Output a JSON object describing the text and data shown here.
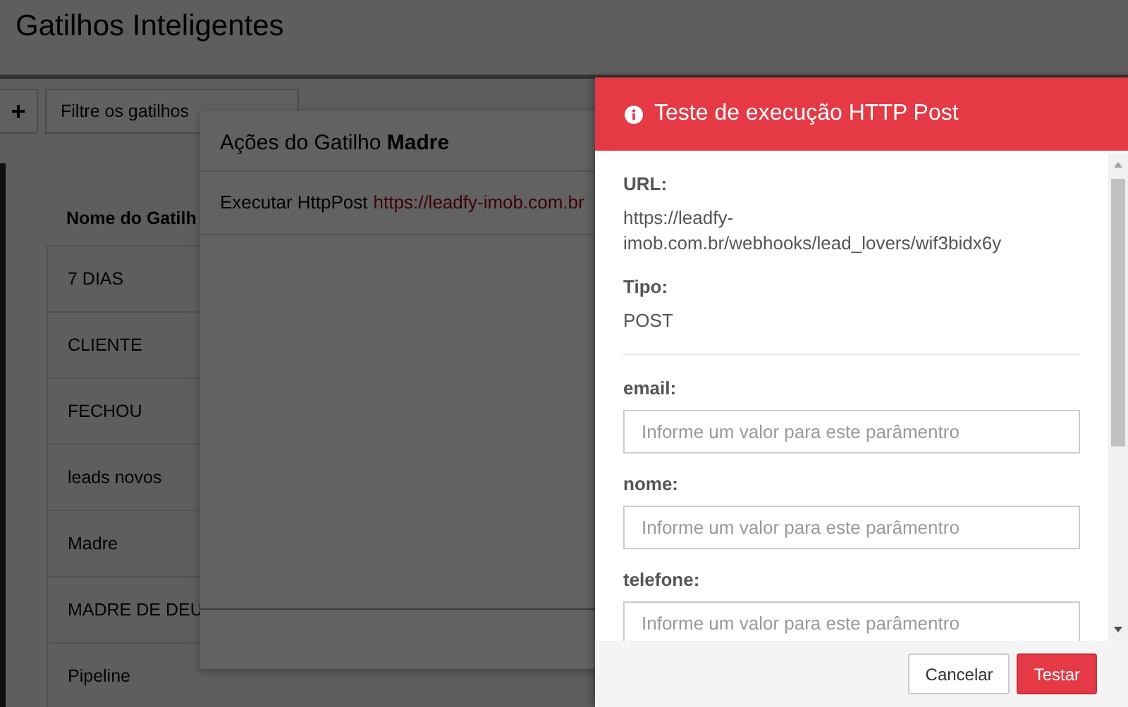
{
  "page_title": "Gatilhos Inteligentes",
  "toolbar": {
    "add_button": "+",
    "filter": {
      "placeholder": "Filtre os gatilhos"
    }
  },
  "table": {
    "column": "Nome do Gatilh",
    "rows": [
      "7 DIAS",
      "CLIENTE",
      "FECHOU",
      "leads novos",
      "Madre",
      "MADRE DE DEU",
      "Pipeline"
    ]
  },
  "actions_modal": {
    "title": "Ações do Gatilho **Madre**",
    "action": {
      "label": "Executar HttpPost",
      "url": "https://leadfy-imob.com.br"
    }
  },
  "test_panel": {
    "title": "Teste de execução HTTP Post",
    "url_label": "URL:",
    "url": "https://leadfy-imob.com.br/webhooks/lead_lovers/wif3bidx6y",
    "type_label": "Tipo:",
    "type": "POST",
    "params": [
      {
        "label": "email:",
        "placeholder": "Informe um valor para este parâmentro"
      },
      {
        "label": "nome:",
        "placeholder": "Informe um valor para este parâmentro"
      },
      {
        "label": "telefone:",
        "placeholder": "Informe um valor para este parâmentro"
      }
    ],
    "buttons": [
      {
        "kind": "cancel",
        "label": "Cancelar"
      },
      {
        "kind": "primary",
        "label": "Testar"
      }
    ]
  }
}
